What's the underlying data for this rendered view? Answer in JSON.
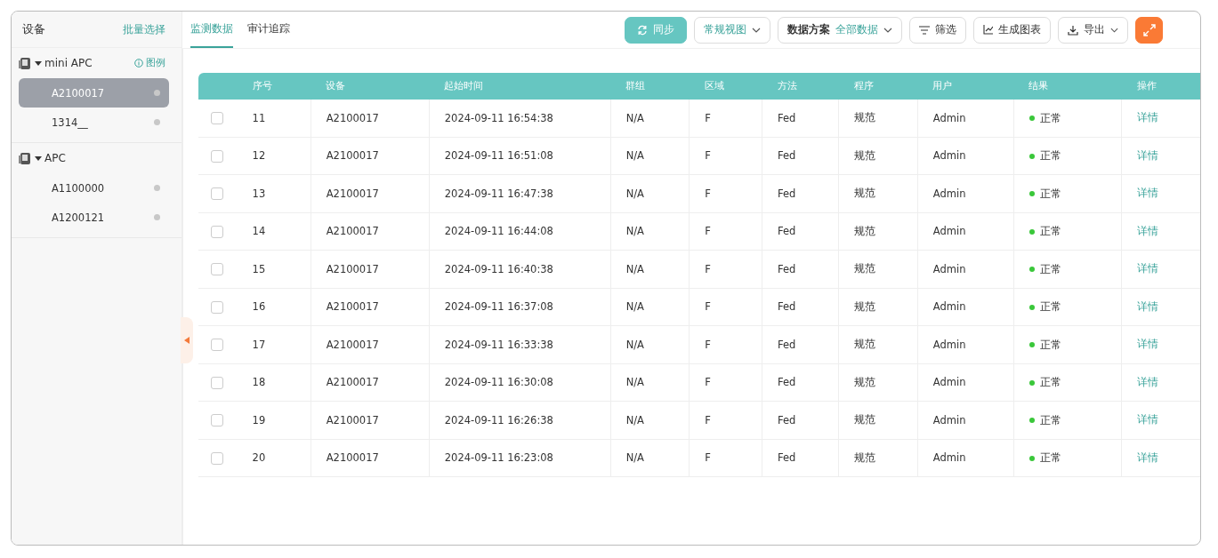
{
  "sidebar": {
    "title": "设备",
    "batch_select": "批量选择",
    "groups": [
      {
        "name": "mini APC",
        "expanded": true,
        "legend": "图例",
        "children": [
          {
            "label": "A2100017",
            "selected": true
          },
          {
            "label": "1314__",
            "selected": false
          }
        ]
      },
      {
        "name": "APC",
        "expanded": true,
        "children": [
          {
            "label": "A1100000",
            "selected": false
          },
          {
            "label": "A1200121",
            "selected": false
          }
        ]
      }
    ]
  },
  "tabs": [
    {
      "label": "监测数据",
      "selected": true
    },
    {
      "label": "审计追踪",
      "selected": false
    }
  ],
  "toolbar": {
    "sync": "同步",
    "view": "常规视图",
    "scheme_label": "数据方案",
    "scheme_value": "全部数据",
    "filter": "筛选",
    "chart": "生成图表",
    "export": "导出"
  },
  "table": {
    "columns": [
      "序号",
      "设备",
      "起始时间",
      "群组",
      "区域",
      "方法",
      "程序",
      "用户",
      "结果",
      "操作"
    ],
    "rows": [
      {
        "checked": false,
        "cells": [
          "11",
          "A2100017",
          "2024-09-11 16:54:38",
          "N/A",
          "F",
          "Fed",
          "规范",
          "Admin",
          "正常",
          "详情"
        ]
      },
      {
        "checked": false,
        "cells": [
          "12",
          "A2100017",
          "2024-09-11 16:51:08",
          "N/A",
          "F",
          "Fed",
          "规范",
          "Admin",
          "正常",
          "详情"
        ]
      },
      {
        "checked": false,
        "cells": [
          "13",
          "A2100017",
          "2024-09-11 16:47:38",
          "N/A",
          "F",
          "Fed",
          "规范",
          "Admin",
          "正常",
          "详情"
        ]
      },
      {
        "checked": false,
        "cells": [
          "14",
          "A2100017",
          "2024-09-11 16:44:08",
          "N/A",
          "F",
          "Fed",
          "规范",
          "Admin",
          "正常",
          "详情"
        ]
      },
      {
        "checked": false,
        "cells": [
          "15",
          "A2100017",
          "2024-09-11 16:40:38",
          "N/A",
          "F",
          "Fed",
          "规范",
          "Admin",
          "正常",
          "详情"
        ]
      },
      {
        "checked": false,
        "cells": [
          "16",
          "A2100017",
          "2024-09-11 16:37:08",
          "N/A",
          "F",
          "Fed",
          "规范",
          "Admin",
          "正常",
          "详情"
        ]
      },
      {
        "checked": false,
        "cells": [
          "17",
          "A2100017",
          "2024-09-11 16:33:38",
          "N/A",
          "F",
          "Fed",
          "规范",
          "Admin",
          "正常",
          "详情"
        ]
      },
      {
        "checked": false,
        "cells": [
          "18",
          "A2100017",
          "2024-09-11 16:30:08",
          "N/A",
          "F",
          "Fed",
          "规范",
          "Admin",
          "正常",
          "详情"
        ]
      },
      {
        "checked": false,
        "cells": [
          "19",
          "A2100017",
          "2024-09-11 16:26:38",
          "N/A",
          "F",
          "Fed",
          "规范",
          "Admin",
          "正常",
          "详情"
        ]
      },
      {
        "checked": false,
        "cells": [
          "20",
          "A2100017",
          "2024-09-11 16:23:08",
          "N/A",
          "F",
          "Fed",
          "规范",
          "Admin",
          "正常",
          "详情"
        ]
      }
    ]
  }
}
